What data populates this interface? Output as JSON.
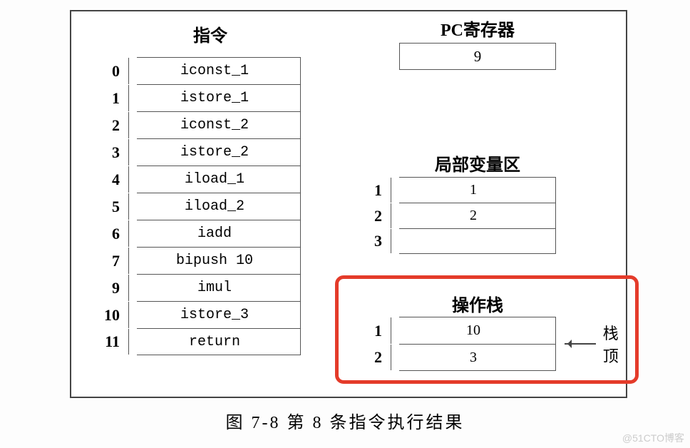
{
  "headers": {
    "instructions": "指令",
    "pc": "PC寄存器",
    "localvars": "局部变量区",
    "opstack": "操作栈"
  },
  "instructions": [
    {
      "addr": "0",
      "op": "iconst_1"
    },
    {
      "addr": "1",
      "op": "istore_1"
    },
    {
      "addr": "2",
      "op": "iconst_2"
    },
    {
      "addr": "3",
      "op": "istore_2"
    },
    {
      "addr": "4",
      "op": "iload_1"
    },
    {
      "addr": "5",
      "op": "iload_2"
    },
    {
      "addr": "6",
      "op": "iadd"
    },
    {
      "addr": "7",
      "op": "bipush  10"
    },
    {
      "addr": "9",
      "op": "imul"
    },
    {
      "addr": "10",
      "op": "istore_3"
    },
    {
      "addr": "11",
      "op": "return"
    }
  ],
  "pc": "9",
  "localvars": [
    {
      "slot": "1",
      "val": "1"
    },
    {
      "slot": "2",
      "val": "2"
    },
    {
      "slot": "3",
      "val": ""
    }
  ],
  "opstack": [
    {
      "slot": "1",
      "val": "10"
    },
    {
      "slot": "2",
      "val": "3"
    }
  ],
  "stack_top_label": "栈顶",
  "caption": "图 7-8  第 8 条指令执行结果",
  "watermark": "@51CTO博客",
  "chart_data": {
    "type": "diagram",
    "title": "图 7-8 第 8 条指令执行结果",
    "pc_register": 9,
    "instruction_sequence": [
      {
        "addr": 0,
        "opcode": "iconst_1"
      },
      {
        "addr": 1,
        "opcode": "istore_1"
      },
      {
        "addr": 2,
        "opcode": "iconst_2"
      },
      {
        "addr": 3,
        "opcode": "istore_2"
      },
      {
        "addr": 4,
        "opcode": "iload_1"
      },
      {
        "addr": 5,
        "opcode": "iload_2"
      },
      {
        "addr": 6,
        "opcode": "iadd"
      },
      {
        "addr": 7,
        "opcode": "bipush 10"
      },
      {
        "addr": 9,
        "opcode": "imul"
      },
      {
        "addr": 10,
        "opcode": "istore_3"
      },
      {
        "addr": 11,
        "opcode": "return"
      }
    ],
    "local_variable_table": {
      "1": 1,
      "2": 2,
      "3": null
    },
    "operand_stack": [
      10,
      3
    ],
    "stack_top_index": 1,
    "highlighted_region": "operand_stack"
  }
}
